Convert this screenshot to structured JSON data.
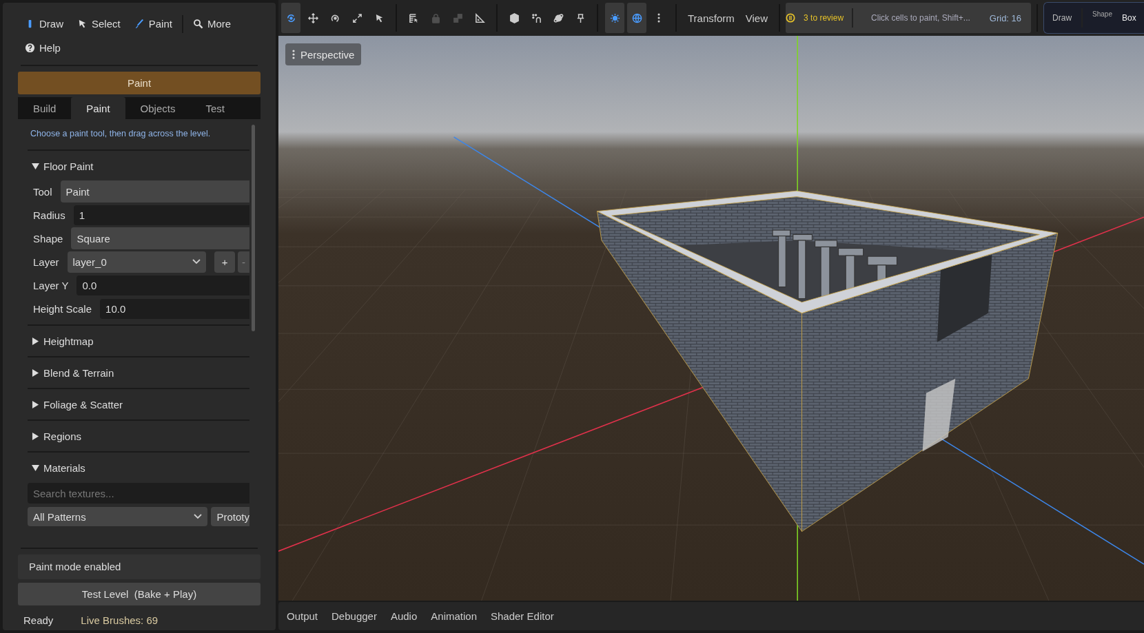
{
  "left_panel": {
    "toolbar": [
      {
        "label": "Draw"
      },
      {
        "label": "Select"
      },
      {
        "label": "Paint"
      },
      {
        "label": "More"
      },
      {
        "label": "Help"
      }
    ],
    "mode_banner": "Paint",
    "tabs": [
      {
        "label": "Build",
        "selected": false
      },
      {
        "label": "Paint",
        "selected": true
      },
      {
        "label": "Objects",
        "selected": false
      },
      {
        "label": "Test",
        "selected": false
      }
    ],
    "hint": "Choose a paint tool, then drag across the level.",
    "sections": [
      {
        "title": "Floor Paint",
        "expanded": true,
        "fields": [
          {
            "label": "Tool",
            "kind": "option",
            "value": "Paint"
          },
          {
            "label": "Radius",
            "kind": "input",
            "value": "1"
          },
          {
            "label": "Shape",
            "kind": "option",
            "value": "Square"
          },
          {
            "label": "Layer",
            "kind": "dropdown",
            "value": "layer_0",
            "buttons": [
              "+",
              "-"
            ]
          },
          {
            "label": "Layer Y",
            "kind": "input",
            "value": "0.0"
          },
          {
            "label": "Height Scale",
            "kind": "input",
            "value": "10.0"
          }
        ]
      },
      {
        "title": "Heightmap",
        "expanded": false
      },
      {
        "title": "Blend & Terrain",
        "expanded": false
      },
      {
        "title": "Foliage & Scatter",
        "expanded": false
      },
      {
        "title": "Regions",
        "expanded": false
      },
      {
        "title": "Materials",
        "expanded": true,
        "search": {
          "placeholder": "Search textures..."
        },
        "filter": "All Patterns",
        "filter_button": "Prototy"
      }
    ],
    "status_message": "Paint mode enabled",
    "test_button": "Test Level  (Bake + Play)",
    "status_bar": {
      "state": "Ready",
      "brushes": "Live Brushes: 69"
    }
  },
  "viewport_toolbar": {
    "tools": [
      {
        "selected": true,
        "disabled": false
      },
      {
        "selected": false,
        "disabled": false
      },
      {
        "selected": false,
        "disabled": false
      },
      {
        "selected": false,
        "disabled": false
      },
      {
        "selected": false,
        "disabled": false
      },
      {
        "selected": false,
        "disabled": false
      },
      {
        "selected": false,
        "disabled": true
      },
      {
        "selected": false,
        "disabled": true
      },
      {
        "selected": false,
        "disabled": false
      },
      {
        "selected": false,
        "disabled": false
      },
      {
        "selected": false,
        "disabled": false
      },
      {
        "selected": false,
        "disabled": false
      },
      {
        "selected": false,
        "disabled": false
      },
      {
        "selected": true,
        "disabled": false
      },
      {
        "selected": true,
        "disabled": false
      },
      {
        "selected": false,
        "disabled": false
      }
    ],
    "menus": [
      "Transform",
      "View"
    ],
    "review": "3 to review",
    "status_hint": "Click cells to paint, Shift+...",
    "grid": "Grid: 16",
    "mode_panel": {
      "draw": "Draw",
      "shape_label": "Shape",
      "shape": "Box"
    }
  },
  "viewport": {
    "view_menu": "Perspective"
  },
  "bottom_tabs": [
    "Output",
    "Debugger",
    "Audio",
    "Animation",
    "Shader Editor"
  ]
}
